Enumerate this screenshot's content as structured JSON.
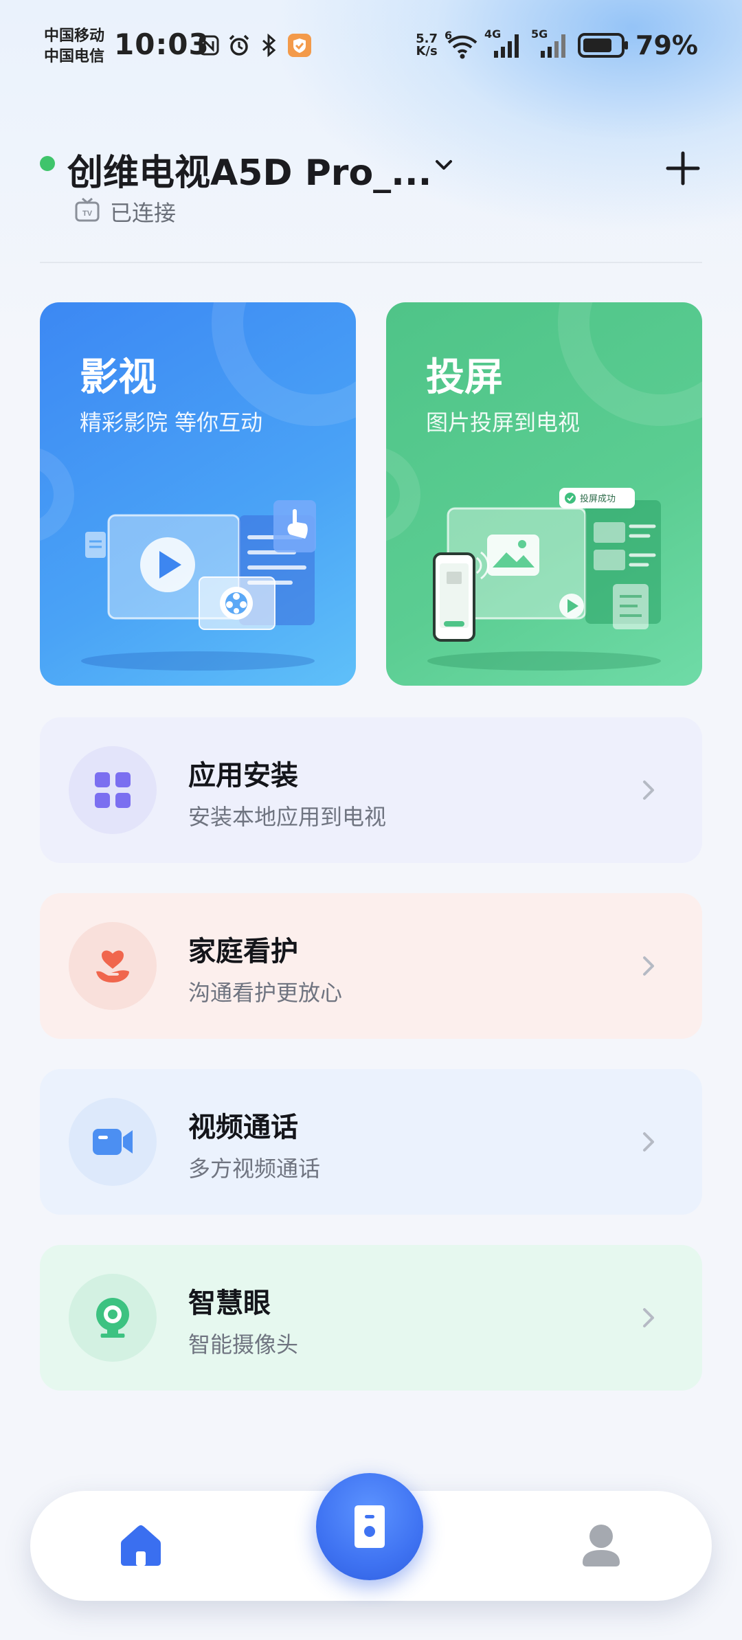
{
  "status_bar": {
    "carrier_1": "中国移动",
    "carrier_2": "中国电信",
    "time": "10:03",
    "speed_value": "5.7",
    "speed_unit": "K/s",
    "wifi_label": "6",
    "net1": "4G",
    "net2": "5G",
    "battery": "79%",
    "battery_level": 0.79
  },
  "device": {
    "name": "创维电视A5D Pro_...",
    "status": "已连接",
    "tv_badge": "TV"
  },
  "cards": {
    "video": {
      "title": "影视",
      "subtitle": "精彩影院 等你互动"
    },
    "cast": {
      "title": "投屏",
      "subtitle": "图片投屏到电视",
      "toast": "投屏成功"
    }
  },
  "list": [
    {
      "title": "应用安装",
      "subtitle": "安装本地应用到电视",
      "icon": "apps-grid-icon",
      "bg": "#eef0fc",
      "icon_bg": "#e3e4fa",
      "accent": "#7b6ff0"
    },
    {
      "title": "家庭看护",
      "subtitle": "沟通看护更放心",
      "icon": "heart-hand-icon",
      "bg": "#fcefed",
      "icon_bg": "#f9e0db",
      "accent": "#f0664d"
    },
    {
      "title": "视频通话",
      "subtitle": "多方视频通话",
      "icon": "video-camera-icon",
      "bg": "#ebf2fd",
      "icon_bg": "#dde9fb",
      "accent": "#4c8ff2"
    },
    {
      "title": "智慧眼",
      "subtitle": "智能摄像头",
      "icon": "webcam-icon",
      "bg": "#e6f8ef",
      "icon_bg": "#d3f1e2",
      "accent": "#3dc281"
    }
  ],
  "nav": {
    "home_icon": "home-icon",
    "remote_icon": "remote-control-icon",
    "profile_icon": "profile-icon",
    "active_color": "#3a6ff0"
  }
}
